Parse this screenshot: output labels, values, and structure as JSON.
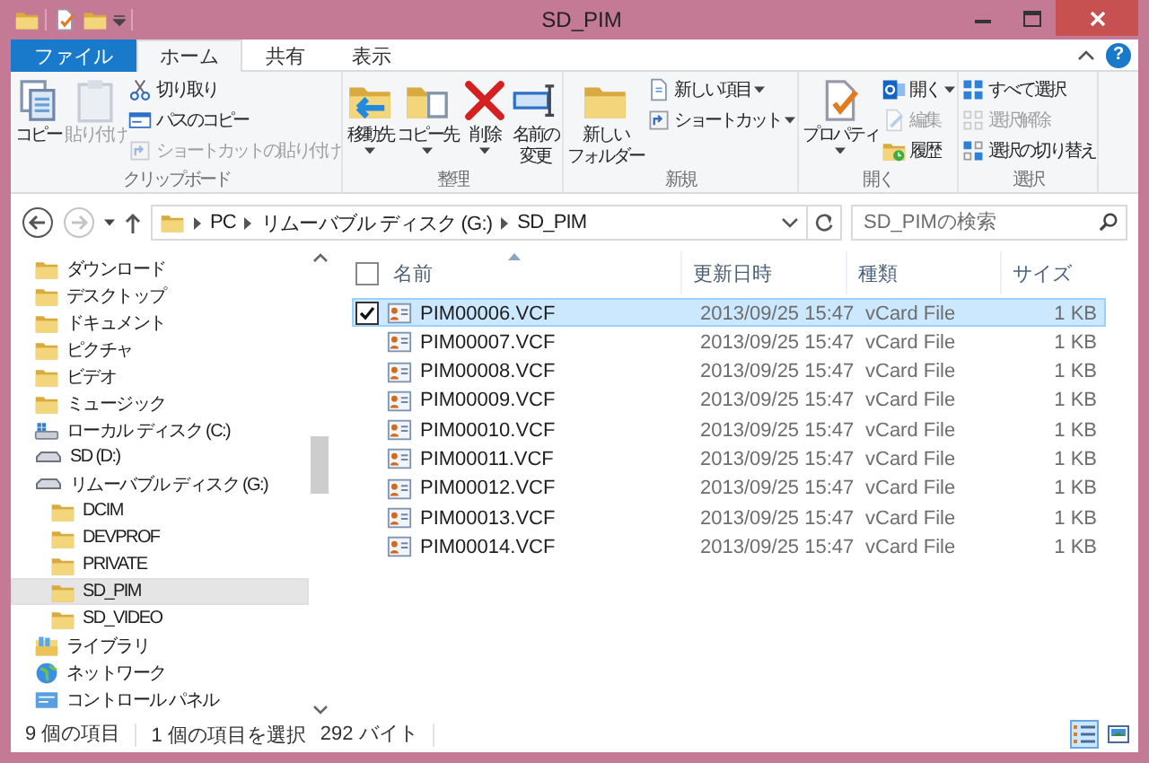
{
  "window": {
    "title": "SD_PIM"
  },
  "ribbon_tabs": [
    {
      "label": "ファイル",
      "kind": "file",
      "selected": false
    },
    {
      "label": "ホーム",
      "kind": "tab",
      "selected": true
    },
    {
      "label": "共有",
      "kind": "tab",
      "selected": false
    },
    {
      "label": "表示",
      "kind": "tab",
      "selected": false
    }
  ],
  "help_button": {
    "label": "?"
  },
  "ribbon_groups": [
    {
      "label": "クリップボード",
      "items": [
        {
          "lines": [
            "コピー"
          ],
          "kind": "large",
          "dropdown": false,
          "disabled": false
        },
        {
          "lines": [
            "貼り付け"
          ],
          "kind": "large",
          "dropdown": false,
          "disabled": true
        },
        {
          "label": "切り取り",
          "kind": "small",
          "dropdown": false,
          "disabled": false
        },
        {
          "label": "パスのコピー",
          "kind": "small",
          "dropdown": false,
          "disabled": false
        },
        {
          "label": "ショートカットの貼り付け",
          "kind": "small",
          "dropdown": false,
          "disabled": true
        }
      ]
    },
    {
      "label": "整理",
      "items": [
        {
          "lines": [
            "移動先"
          ],
          "kind": "large",
          "dropdown": true,
          "disabled": false
        },
        {
          "lines": [
            "コピー先"
          ],
          "kind": "large",
          "dropdown": true,
          "disabled": false
        },
        {
          "lines": [
            "削除"
          ],
          "kind": "large",
          "dropdown": true,
          "disabled": false
        },
        {
          "lines": [
            "名前の",
            "変更"
          ],
          "kind": "large",
          "dropdown": false,
          "disabled": false
        }
      ]
    },
    {
      "label": "新規",
      "items": [
        {
          "lines": [
            "新しい",
            "フォルダー"
          ],
          "kind": "large",
          "dropdown": false,
          "disabled": false
        },
        {
          "label": "新しい項目",
          "kind": "small",
          "dropdown": true,
          "disabled": false
        },
        {
          "label": "ショートカット",
          "kind": "small",
          "dropdown": true,
          "disabled": false
        }
      ]
    },
    {
      "label": "開く",
      "items": [
        {
          "lines": [
            "プロパティ"
          ],
          "kind": "large",
          "dropdown": true,
          "disabled": false
        },
        {
          "label": "開く",
          "kind": "small",
          "dropdown": true,
          "disabled": false
        },
        {
          "label": "編集",
          "kind": "small",
          "dropdown": false,
          "disabled": true
        },
        {
          "label": "履歴",
          "kind": "small",
          "dropdown": false,
          "disabled": false
        }
      ]
    },
    {
      "label": "選択",
      "items": [
        {
          "label": "すべて選択",
          "kind": "small",
          "dropdown": false,
          "disabled": false
        },
        {
          "label": "選択解除",
          "kind": "small",
          "dropdown": false,
          "disabled": true
        },
        {
          "label": "選択の切り替え",
          "kind": "small",
          "dropdown": false,
          "disabled": false
        }
      ]
    }
  ],
  "address": {
    "crumbs": [
      "PC",
      "リムーバブル ディスク (G:)",
      "SD_PIM"
    ]
  },
  "search": {
    "placeholder": "SD_PIMの検索"
  },
  "nav": {
    "items": [
      {
        "label": "ダウンロード",
        "kind": "folder",
        "selected": false
      },
      {
        "label": "デスクトップ",
        "kind": "folder",
        "selected": false
      },
      {
        "label": "ドキュメント",
        "kind": "folder",
        "selected": false
      },
      {
        "label": "ピクチャ",
        "kind": "folder",
        "selected": false
      },
      {
        "label": "ビデオ",
        "kind": "folder",
        "selected": false
      },
      {
        "label": "ミュージック",
        "kind": "folder",
        "selected": false
      },
      {
        "label": "ローカル ディスク (C:)",
        "kind": "drive",
        "selected": false
      },
      {
        "label": "SD (D:)",
        "kind": "removable",
        "selected": false
      },
      {
        "label": "リムーバブル ディスク (G:)",
        "kind": "removable",
        "selected": false,
        "children": [
          {
            "label": "DCIM",
            "kind": "folder",
            "selected": false
          },
          {
            "label": "DEVPROF",
            "kind": "folder",
            "selected": false
          },
          {
            "label": "PRIVATE",
            "kind": "folder",
            "selected": false
          },
          {
            "label": "SD_PIM",
            "kind": "folder",
            "selected": true
          },
          {
            "label": "SD_VIDEO",
            "kind": "folder",
            "selected": false
          }
        ]
      },
      {
        "label": "ライブラリ",
        "kind": "library",
        "selected": false
      },
      {
        "label": "ネットワーク",
        "kind": "network",
        "selected": false
      },
      {
        "label": "コントロール パネル",
        "kind": "control",
        "selected": false
      }
    ]
  },
  "files": {
    "columns": [
      "名前",
      "更新日時",
      "種類",
      "サイズ"
    ],
    "all_selected": false,
    "rows": [
      {
        "name": "PIM00006.VCF",
        "modified": "2013/09/25 15:47",
        "type": "vCard File",
        "size": "1 KB",
        "selected": true
      },
      {
        "name": "PIM00007.VCF",
        "modified": "2013/09/25 15:47",
        "type": "vCard File",
        "size": "1 KB",
        "selected": false
      },
      {
        "name": "PIM00008.VCF",
        "modified": "2013/09/25 15:47",
        "type": "vCard File",
        "size": "1 KB",
        "selected": false
      },
      {
        "name": "PIM00009.VCF",
        "modified": "2013/09/25 15:47",
        "type": "vCard File",
        "size": "1 KB",
        "selected": false
      },
      {
        "name": "PIM00010.VCF",
        "modified": "2013/09/25 15:47",
        "type": "vCard File",
        "size": "1 KB",
        "selected": false
      },
      {
        "name": "PIM00011.VCF",
        "modified": "2013/09/25 15:47",
        "type": "vCard File",
        "size": "1 KB",
        "selected": false
      },
      {
        "name": "PIM00012.VCF",
        "modified": "2013/09/25 15:47",
        "type": "vCard File",
        "size": "1 KB",
        "selected": false
      },
      {
        "name": "PIM00013.VCF",
        "modified": "2013/09/25 15:47",
        "type": "vCard File",
        "size": "1 KB",
        "selected": false
      },
      {
        "name": "PIM00014.VCF",
        "modified": "2013/09/25 15:47",
        "type": "vCard File",
        "size": "1 KB",
        "selected": false
      }
    ]
  },
  "status_bar": {
    "item_count": "9 個の項目",
    "selection": "1 個の項目を選択",
    "selection_size": "292 バイト"
  },
  "view_modes": [
    {
      "kind": "details",
      "selected": true
    },
    {
      "kind": "large_icons",
      "selected": false
    }
  ]
}
